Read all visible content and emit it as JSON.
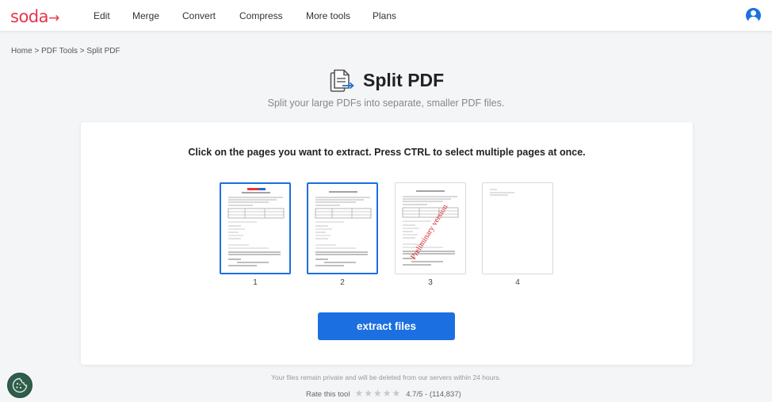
{
  "header": {
    "logo": "soda",
    "logo_arrow": "→",
    "nav": [
      {
        "label": "Edit"
      },
      {
        "label": "Merge"
      },
      {
        "label": "Convert"
      },
      {
        "label": "Compress"
      },
      {
        "label": "More tools"
      },
      {
        "label": "Plans"
      }
    ],
    "avatar_icon": "user-avatar-icon"
  },
  "breadcrumb": "Home > PDF Tools > Split PDF",
  "hero": {
    "title": "Split PDF",
    "subtitle": "Split your large PDFs into separate, smaller PDF files.",
    "icon": "split-pdf-icon"
  },
  "card": {
    "instruction": "Click on the pages you want to extract. Press CTRL to select multiple pages at once.",
    "pages": [
      {
        "number": "1",
        "selected": true
      },
      {
        "number": "2",
        "selected": true
      },
      {
        "number": "3",
        "selected": false,
        "watermark": "Preliminary version"
      },
      {
        "number": "4",
        "selected": false
      }
    ],
    "extract_label": "extract files"
  },
  "footer": {
    "privacy": "Your files remain private and will be deleted from our servers within 24 hours.",
    "rate_label": "Rate this tool",
    "stars": "★★★★★",
    "score": "4.7/5 - (114,837)"
  },
  "colors": {
    "brand": "#e8334a",
    "accent": "#1c6fe0",
    "cookie": "#2f5d4b"
  }
}
